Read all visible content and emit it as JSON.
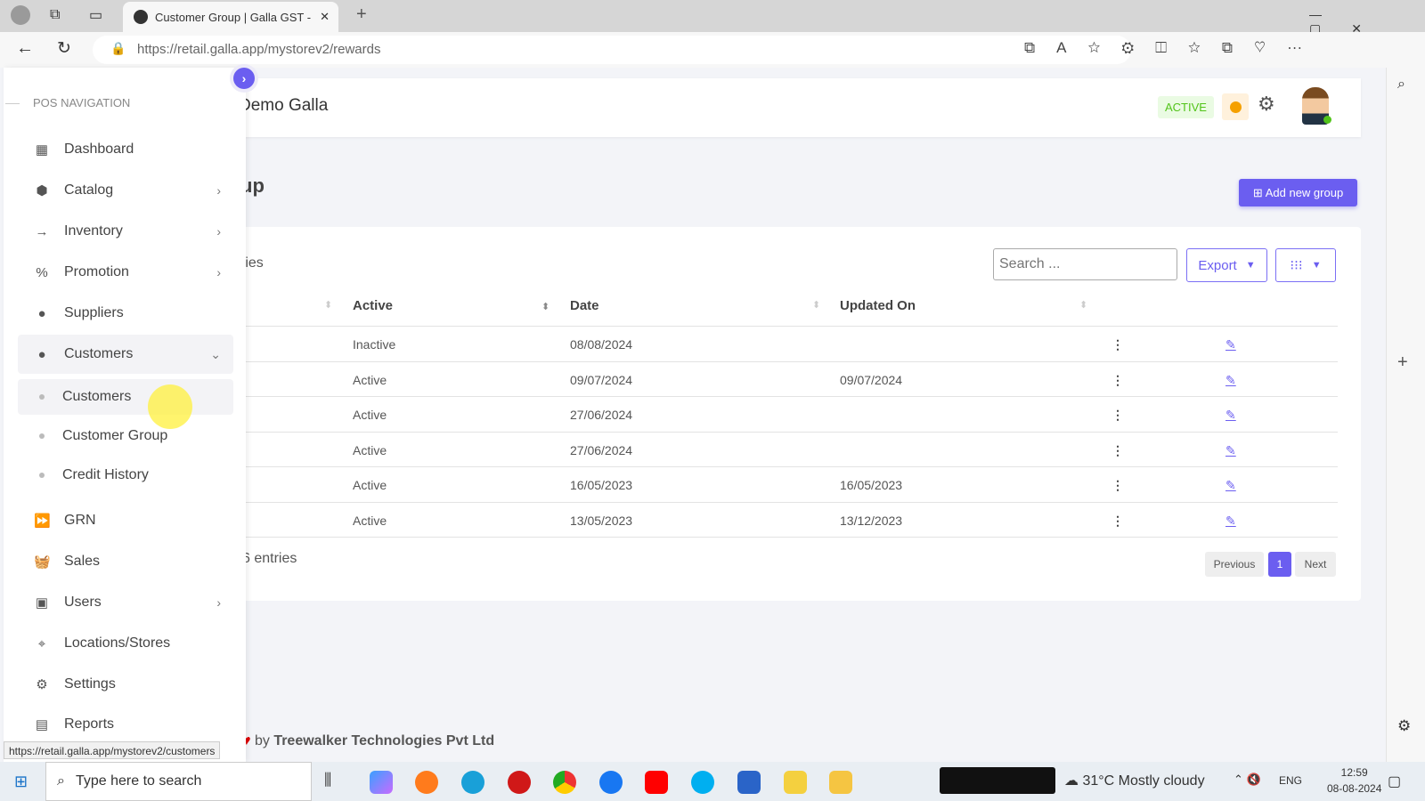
{
  "browser": {
    "tab_title": "Customer Group | Galla GST - Inv",
    "url": "https://retail.galla.app/mystorev2/rewards",
    "status_url": "https://retail.galla.app/mystorev2/customers"
  },
  "header": {
    "store": "Demo Galla",
    "status": "ACTIVE"
  },
  "sidebar": {
    "heading": "POS NAVIGATION",
    "items": [
      {
        "label": "Dashboard",
        "icon": "dashboard-icon",
        "glyph": "▦"
      },
      {
        "label": "Catalog",
        "icon": "box-icon",
        "glyph": "⬢",
        "chevron": "›"
      },
      {
        "label": "Inventory",
        "icon": "arrow-right-icon",
        "glyph": "→",
        "chevron": "›"
      },
      {
        "label": "Promotion",
        "icon": "ticket-icon",
        "glyph": "%",
        "chevron": "›"
      },
      {
        "label": "Suppliers",
        "icon": "user-circle-icon",
        "glyph": "●"
      },
      {
        "label": "Customers",
        "icon": "user-circle-icon",
        "glyph": "●",
        "chevron": "⌄"
      },
      {
        "label": "GRN",
        "icon": "forward-icon",
        "glyph": "⏩"
      },
      {
        "label": "Sales",
        "icon": "basket-icon",
        "glyph": "🧺"
      },
      {
        "label": "Users",
        "icon": "id-card-icon",
        "glyph": "▣",
        "chevron": "›"
      },
      {
        "label": "Locations/Stores",
        "icon": "location-pin-icon",
        "glyph": "⌖"
      },
      {
        "label": "Settings",
        "icon": "gear-icon",
        "glyph": "⚙"
      },
      {
        "label": "Reports",
        "icon": "file-icon",
        "glyph": "▤"
      }
    ],
    "subitems": [
      "Customers",
      "Customer Group",
      "Credit History"
    ]
  },
  "page": {
    "title_partial": "up",
    "add_button": "Add new group",
    "entries_top": "ries",
    "entries_bottom": "6 entries",
    "search_placeholder": "Search ...",
    "export": "Export"
  },
  "table": {
    "columns": [
      "Active",
      "Date",
      "Updated On"
    ],
    "rows": [
      {
        "active": "Inactive",
        "date": "08/08/2024",
        "updated": ""
      },
      {
        "active": "Active",
        "date": "09/07/2024",
        "updated": "09/07/2024"
      },
      {
        "active": "Active",
        "date": "27/06/2024",
        "updated": ""
      },
      {
        "active": "Active",
        "date": "27/06/2024",
        "updated": ""
      },
      {
        "active": "Active",
        "date": "16/05/2023",
        "updated": "16/05/2023"
      },
      {
        "active": "Active",
        "date": "13/05/2023",
        "updated": "13/12/2023"
      }
    ]
  },
  "pagination": {
    "previous": "Previous",
    "current": "1",
    "next": "Next"
  },
  "footer": {
    "prefix": "by",
    "company": "Treewalker Technologies Pvt Ltd"
  },
  "taskbar": {
    "search": "Type here to search",
    "weather": "31°C  Mostly cloudy",
    "lang": "ENG",
    "time": "12:59",
    "date": "08-08-2024"
  },
  "colors": {
    "accent": "#6b5ef0",
    "active_badge": "#52c41a"
  }
}
